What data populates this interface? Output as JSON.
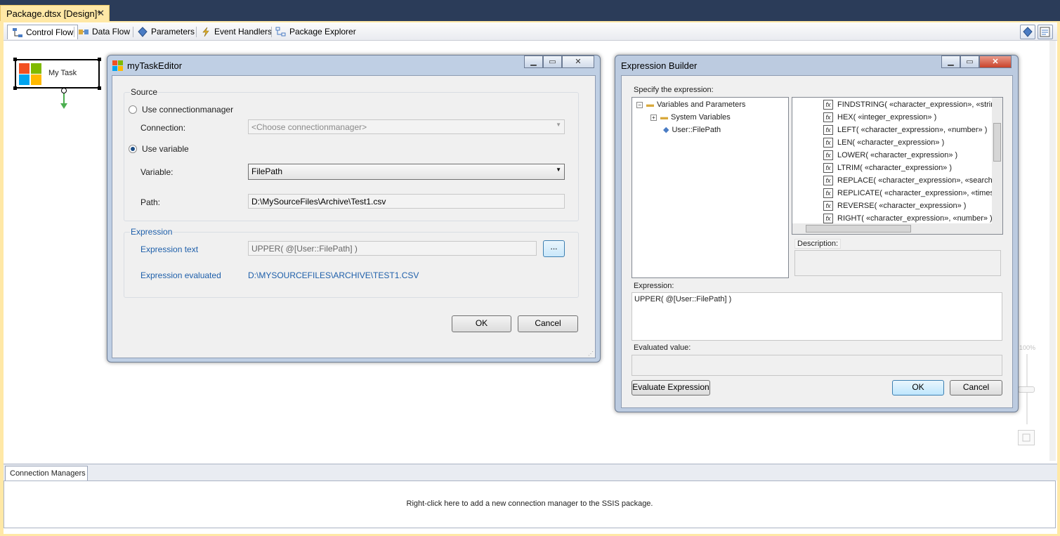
{
  "document_tab": {
    "title": "Package.dtsx [Design]*",
    "close": "✕"
  },
  "designer_tabs": [
    {
      "label": "Control Flow",
      "icon": "control-flow-icon",
      "selected": true
    },
    {
      "label": "Data Flow",
      "icon": "data-flow-icon"
    },
    {
      "label": "Parameters",
      "icon": "parameters-icon"
    },
    {
      "label": "Event Handlers",
      "icon": "event-handlers-icon"
    },
    {
      "label": "Package Explorer",
      "icon": "package-explorer-icon"
    }
  ],
  "task": {
    "label": "My Task"
  },
  "task_editor": {
    "title": "myTaskEditor",
    "source_group": "Source",
    "use_connectionmanager": "Use connectionmanager",
    "connection_label": "Connection:",
    "connection_placeholder": "<Choose connectionmanager>",
    "use_variable": "Use variable",
    "variable_label": "Variable:",
    "variable_value": "FilePath",
    "path_label": "Path:",
    "path_value": "D:\\MySourceFiles\\Archive\\Test1.csv",
    "expression_group": "Expression",
    "expression_text_label": "Expression text",
    "expression_text_value": "UPPER( @[User::FilePath]  )",
    "browse_button": "...",
    "expression_evaluated_label": "Expression evaluated",
    "expression_evaluated_value": "D:\\MYSOURCEFILES\\ARCHIVE\\TEST1.CSV",
    "ok": "OK",
    "cancel": "Cancel"
  },
  "expression_builder": {
    "title": "Expression Builder",
    "specify_label": "Specify the expression:",
    "tree": {
      "root": "Variables and Parameters",
      "system": "System Variables",
      "user": "User::FilePath"
    },
    "functions": [
      "FINDSTRING( «character_expression», «string",
      "HEX( «integer_expression» )",
      "LEFT( «character_expression», «number» )",
      "LEN( «character_expression» )",
      "LOWER( «character_expression» )",
      "LTRIM( «character_expression» )",
      "REPLACE( «character_expression», «search_",
      "REPLICATE( «character_expression», «times»",
      "REVERSE( «character_expression» )",
      "RIGHT( «character_expression», «number» )"
    ],
    "description_label": "Description:",
    "expression_label": "Expression:",
    "expression_value": "UPPER( @[User::FilePath]  )",
    "evaluated_label": "Evaluated value:",
    "evaluate_button": "Evaluate Expression",
    "ok": "OK",
    "cancel": "Cancel"
  },
  "zoom": {
    "level": "100%"
  },
  "connection_managers": {
    "tab": "Connection Managers",
    "hint": "Right-click here to add a new connection manager to the SSIS package."
  }
}
